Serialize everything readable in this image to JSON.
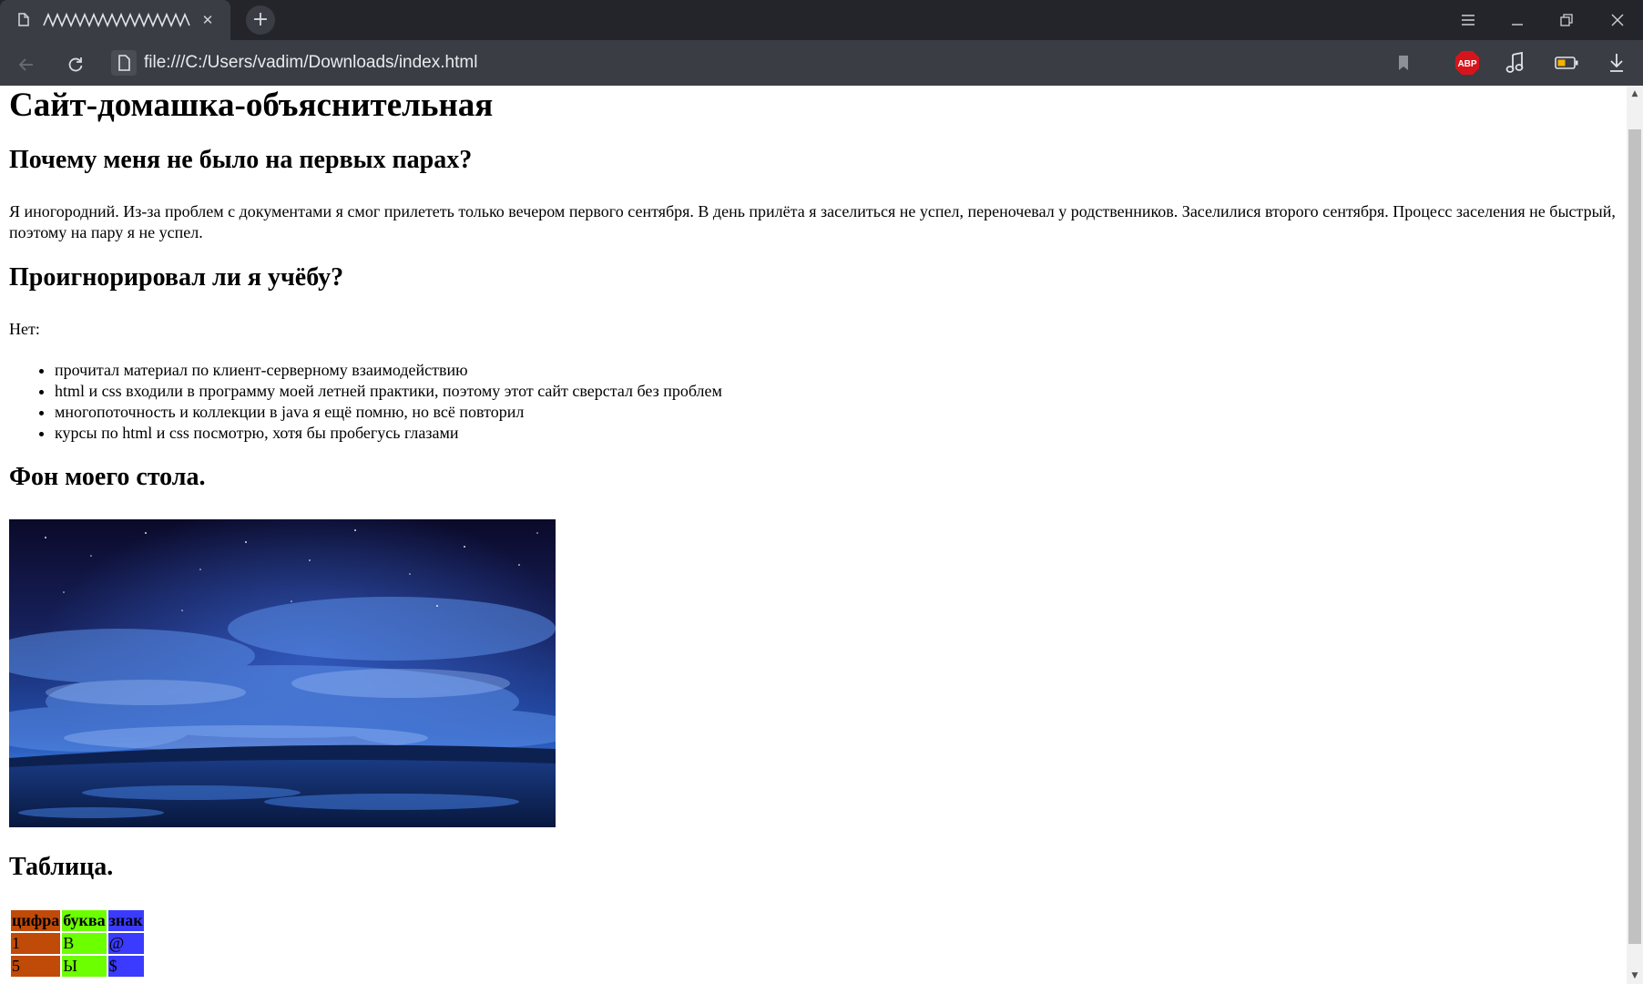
{
  "browser": {
    "tab_title": "ʌʌʌʌʌʌʌʌʌʌʌʌʌʌʌʌ",
    "tab_close": "✕",
    "new_tab": "+",
    "url": "file:///C:/Users/vadim/Downloads/index.html",
    "abp_label": "ABP"
  },
  "page": {
    "title": "Сайт-домашка-объяснительная",
    "section1": {
      "heading": "Почему меня не было на первых парах?",
      "text": "Я иногородний. Из-за проблем с документами я смог прилететь только вечером первого сентября. В день прилёта я заселиться не успел, переночевал у родственников. Заселилися второго сентября. Процесс заселения не быстрый, поэтому на пару я не успел."
    },
    "section2": {
      "heading": "Проигнорировал ли я учёбу?",
      "intro": "Нет:",
      "items": [
        "прочитал материал по клиент-серверному взаимодействию",
        "html и css входили в программу моей летней практики, поэтому этот сайт сверстал без проблем",
        "многопоточность и коллекции в java я ещё помню, но всё повторил",
        "курсы по html и css посмотрю, хотя бы пробегусь глазами"
      ]
    },
    "section3": {
      "heading": "Фон моего стола."
    },
    "section4": {
      "heading": "Таблица.",
      "table": {
        "headers": [
          "цифра",
          "буква",
          "знак"
        ],
        "rows": [
          [
            "1",
            "B",
            "@"
          ],
          [
            "5",
            "Ы",
            "$"
          ]
        ],
        "colors": [
          "#c04a08",
          "#6cff00",
          "#3b3bff"
        ]
      }
    }
  }
}
